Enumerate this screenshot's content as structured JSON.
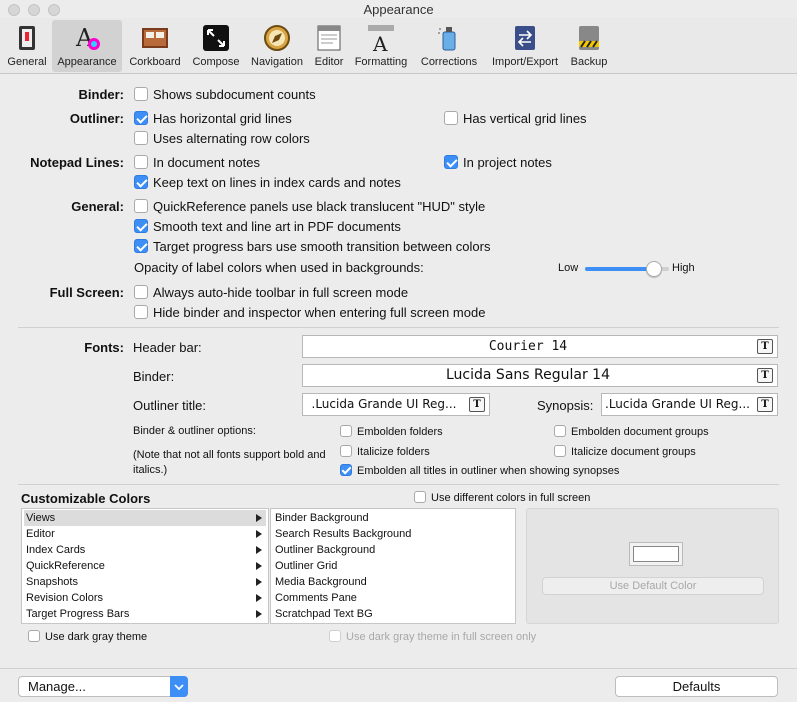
{
  "window": {
    "title": "Appearance"
  },
  "toolbar": {
    "items": [
      {
        "label": "General",
        "icon": "switch-icon"
      },
      {
        "label": "Appearance",
        "icon": "font-color-icon"
      },
      {
        "label": "Corkboard",
        "icon": "corkboard-icon"
      },
      {
        "label": "Compose",
        "icon": "fullscreen-icon"
      },
      {
        "label": "Navigation",
        "icon": "compass-icon"
      },
      {
        "label": "Editor",
        "icon": "editor-window-icon"
      },
      {
        "label": "Formatting",
        "icon": "formatting-icon"
      },
      {
        "label": "Corrections",
        "icon": "spray-icon"
      },
      {
        "label": "Import/Export",
        "icon": "binder-arrows-icon"
      },
      {
        "label": "Backup",
        "icon": "backup-drive-icon"
      }
    ]
  },
  "binder": {
    "label": "Binder:",
    "shows_subdoc": "Shows subdocument counts"
  },
  "outliner": {
    "label": "Outliner:",
    "horiz": "Has horizontal grid lines",
    "vert": "Has vertical grid lines",
    "alt": "Uses alternating row colors"
  },
  "notepad": {
    "label": "Notepad Lines:",
    "in_doc": "In document notes",
    "in_proj": "In project notes",
    "keep": "Keep text on lines in index cards and notes"
  },
  "general": {
    "label": "General:",
    "quickref": "QuickReference panels use black translucent \"HUD\" style",
    "smooth": "Smooth text and line art in PDF documents",
    "target": "Target progress bars use smooth transition between colors",
    "opacity": "Opacity of label colors when used in backgrounds:",
    "low": "Low",
    "high": "High",
    "opacity_value": 0.82
  },
  "fullscreen": {
    "label": "Full Screen:",
    "autohide": "Always auto-hide toolbar in full screen mode",
    "hide": "Hide binder and inspector when entering full screen mode"
  },
  "fonts": {
    "label": "Fonts:",
    "header_label": "Header bar:",
    "header_value": "Courier 14",
    "binder_label": "Binder:",
    "binder_value": "Lucida Sans Regular 14",
    "outliner_title_label": "Outliner title:",
    "outliner_title_value": ".Lucida Grande UI Reg...",
    "synopsis_label": "Synopsis:",
    "synopsis_value": ".Lucida Grande UI Reg...",
    "font_icon": "T",
    "options_label": "Binder & outliner options:",
    "note": "(Note that not all fonts support bold and italics.)",
    "embolden_folders": "Embolden folders",
    "embolden_groups": "Embolden document groups",
    "italicize_folders": "Italicize folders",
    "italicize_groups": "Italicize document groups",
    "embolden_titles": "Embolden all titles in outliner when showing synopses"
  },
  "colors": {
    "title": "Customizable Colors",
    "diff_full": "Use different colors in full screen",
    "categories": [
      "Views",
      "Editor",
      "Index Cards",
      "QuickReference",
      "Snapshots",
      "Revision Colors",
      "Target Progress Bars"
    ],
    "items": [
      "Binder Background",
      "Search Results Background",
      "Outliner Background",
      "Outliner Grid",
      "Media Background",
      "Comments Pane",
      "Scratchpad Text BG"
    ],
    "use_default": "Use Default Color",
    "dark_gray": "Use dark gray theme",
    "dark_gray_full": "Use dark gray theme in full screen only",
    "swatch_color": "#ffffff"
  },
  "footer": {
    "manage": "Manage...",
    "defaults": "Defaults"
  }
}
